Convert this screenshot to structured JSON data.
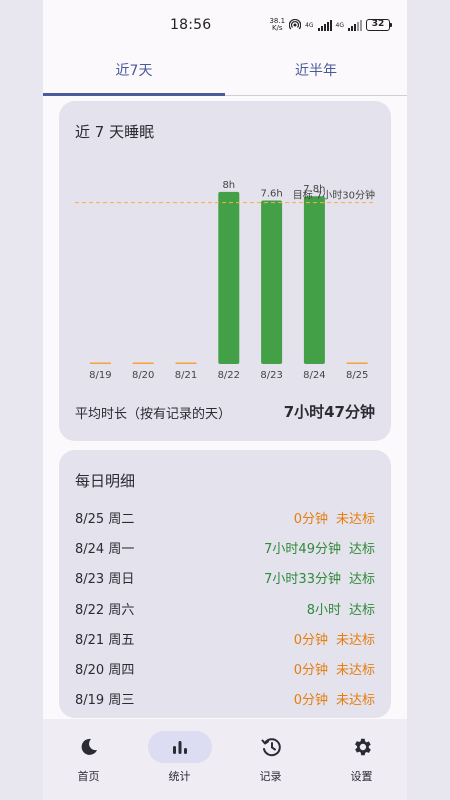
{
  "status": {
    "time": "18:56",
    "net_speed_top": "38.1",
    "net_speed_bottom": "K/s",
    "signal_1": "4G",
    "signal_2": "4G",
    "battery": "32"
  },
  "tabs": [
    {
      "label": "近7天",
      "active": true
    },
    {
      "label": "近半年",
      "active": false
    }
  ],
  "chart_card": {
    "title": "近 7 天睡眠",
    "avg_label": "平均时长（按有记录的天）",
    "avg_value": "7小时47分钟"
  },
  "chart_data": {
    "type": "bar",
    "categories": [
      "8/19",
      "8/20",
      "8/21",
      "8/22",
      "8/23",
      "8/24",
      "8/25"
    ],
    "values": [
      0,
      0,
      0,
      8,
      7.6,
      7.8,
      0
    ],
    "value_labels": [
      "",
      "",
      "",
      "8h",
      "7.6h",
      "7.8h",
      ""
    ],
    "target": 7.5,
    "target_label": "目标 7小时30分钟",
    "ylim": [
      0,
      8.6
    ],
    "unit": "h",
    "colors": {
      "met": "#43a047",
      "unmet": "#f5a23a",
      "target_line": "#f5b04a"
    }
  },
  "detail_card": {
    "title": "每日明细",
    "rows": [
      {
        "date": "8/25 周二",
        "duration": "0分钟",
        "status": "未达标",
        "met": false
      },
      {
        "date": "8/24 周一",
        "duration": "7小时49分钟",
        "status": "达标",
        "met": true
      },
      {
        "date": "8/23 周日",
        "duration": "7小时33分钟",
        "status": "达标",
        "met": true
      },
      {
        "date": "8/22 周六",
        "duration": "8小时",
        "status": "达标",
        "met": true
      },
      {
        "date": "8/21 周五",
        "duration": "0分钟",
        "status": "未达标",
        "met": false
      },
      {
        "date": "8/20 周四",
        "duration": "0分钟",
        "status": "未达标",
        "met": false
      },
      {
        "date": "8/19 周三",
        "duration": "0分钟",
        "status": "未达标",
        "met": false
      }
    ]
  },
  "bottom_nav": [
    {
      "label": "首页",
      "icon": "moon-icon",
      "active": false
    },
    {
      "label": "统计",
      "icon": "bar-chart-icon",
      "active": true
    },
    {
      "label": "记录",
      "icon": "history-icon",
      "active": false
    },
    {
      "label": "设置",
      "icon": "gear-icon",
      "active": false
    }
  ]
}
